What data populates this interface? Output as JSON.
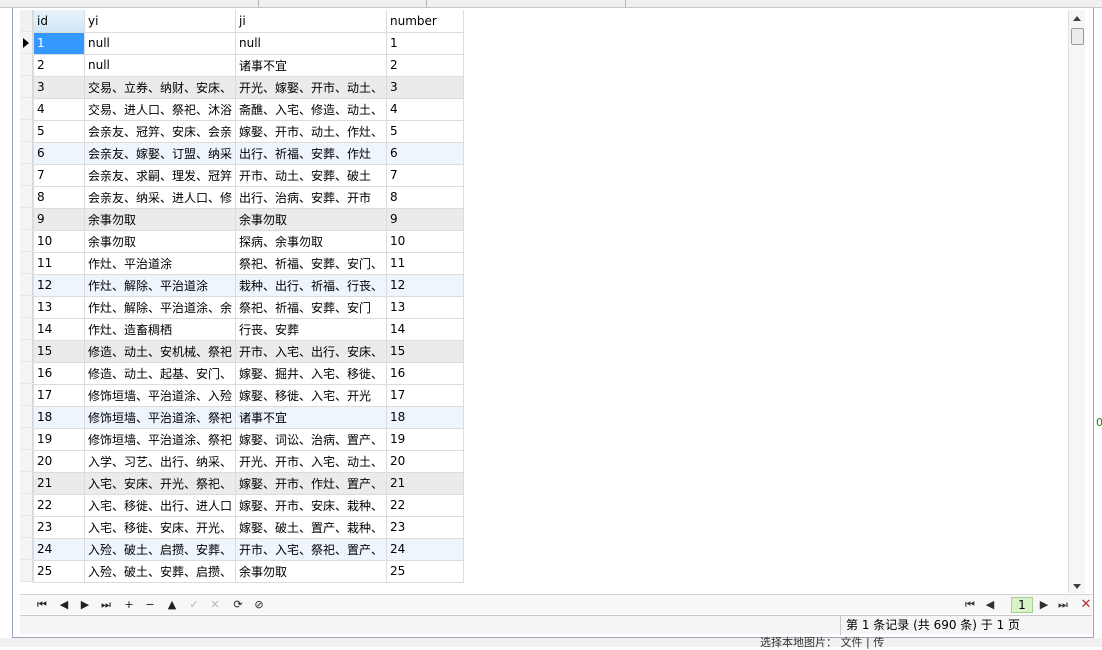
{
  "columns": [
    "id",
    "yi",
    "ji",
    "number"
  ],
  "rows": [
    [
      "1",
      "null",
      "null",
      "1"
    ],
    [
      "2",
      "null",
      "诸事不宜",
      "2"
    ],
    [
      "3",
      "交易、立券、纳财、安床、",
      "开光、嫁娶、开市、动土、",
      "3"
    ],
    [
      "4",
      "交易、进人口、祭祀、沐浴",
      "斋醮、入宅、修造、动土、",
      "4"
    ],
    [
      "5",
      "会亲友、冠笄、安床、会亲",
      "嫁娶、开市、动土、作灶、",
      "5"
    ],
    [
      "6",
      "会亲友、嫁娶、订盟、纳采",
      "出行、祈福、安葬、作灶",
      "6"
    ],
    [
      "7",
      "会亲友、求嗣、理发、冠笄",
      "开市、动土、安葬、破土",
      "7"
    ],
    [
      "8",
      "会亲友、纳采、进人口、修",
      "出行、治病、安葬、开市",
      "8"
    ],
    [
      "9",
      "余事勿取",
      "余事勿取",
      "9"
    ],
    [
      "10",
      "余事勿取",
      "探病、余事勿取",
      "10"
    ],
    [
      "11",
      "作灶、平治道涂",
      "祭祀、祈福、安葬、安门、",
      "11"
    ],
    [
      "12",
      "作灶、解除、平治道涂",
      "栽种、出行、祈福、行丧、",
      "12"
    ],
    [
      "13",
      "作灶、解除、平治道涂、余",
      "祭祀、祈福、安葬、安门",
      "13"
    ],
    [
      "14",
      "作灶、造畜稠栖",
      "行丧、安葬",
      "14"
    ],
    [
      "15",
      "修造、动土、安机械、祭祀",
      "开市、入宅、出行、安床、",
      "15"
    ],
    [
      "16",
      "修造、动土、起基、安门、",
      "嫁娶、掘井、入宅、移徙、",
      "16"
    ],
    [
      "17",
      "修饰垣墙、平治道涂、入殓",
      "嫁娶、移徙、入宅、开光",
      "17"
    ],
    [
      "18",
      "修饰垣墙、平治道涂、祭祀",
      "诸事不宜",
      "18"
    ],
    [
      "19",
      "修饰垣墙、平治道涂、祭祀",
      "嫁娶、词讼、治病、置产、",
      "19"
    ],
    [
      "20",
      "入学、习艺、出行、纳采、",
      "开光、开市、入宅、动土、",
      "20"
    ],
    [
      "21",
      "入宅、安床、开光、祭祀、",
      "嫁娶、开市、作灶、置产、",
      "21"
    ],
    [
      "22",
      "入宅、移徙、出行、进人口",
      "嫁娶、开市、安床、栽种、",
      "22"
    ],
    [
      "23",
      "入宅、移徙、安床、开光、",
      "嫁娶、破土、置产、栽种、",
      "23"
    ],
    [
      "24",
      "入殓、破土、启攒、安葬、",
      "开市、入宅、祭祀、置产、",
      "24"
    ],
    [
      "25",
      "入殓、破土、安葬、启攒、",
      "余事勿取",
      "25"
    ]
  ],
  "navbar": {
    "buttons": [
      {
        "name": "first-record-icon",
        "glyph": "⏮"
      },
      {
        "name": "prev-record-icon",
        "glyph": "◀"
      },
      {
        "name": "next-record-icon",
        "glyph": "▶"
      },
      {
        "name": "last-record-icon",
        "glyph": "⏭"
      },
      {
        "name": "add-record-icon",
        "glyph": "+"
      },
      {
        "name": "delete-record-icon",
        "glyph": "−"
      },
      {
        "name": "move-up-icon",
        "glyph": "▲"
      },
      {
        "name": "apply-changes-icon",
        "glyph": "✓"
      },
      {
        "name": "discard-changes-icon",
        "glyph": "✕"
      },
      {
        "name": "refresh-icon",
        "glyph": "⟳"
      },
      {
        "name": "stop-icon",
        "glyph": "⊘"
      }
    ],
    "page_value": "1"
  },
  "status": {
    "record_text": "第 1 条记录 (共 690 条) 于 1 页"
  },
  "below_fragment": "选择本地图片：  文件 | 传",
  "edge_fragment": "0"
}
